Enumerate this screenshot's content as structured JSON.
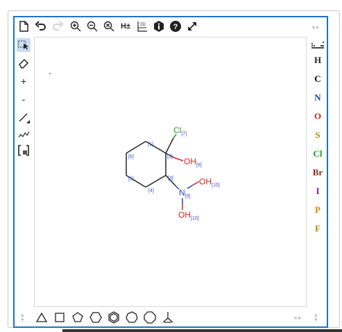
{
  "toolbar_top": {
    "hydrogen_toggle_label": "H±"
  },
  "elements": [
    {
      "symbol": "H",
      "color": "#222222"
    },
    {
      "symbol": "C",
      "color": "#000000"
    },
    {
      "symbol": "N",
      "color": "#1f3fbf"
    },
    {
      "symbol": "O",
      "color": "#e0201c"
    },
    {
      "symbol": "S",
      "color": "#b39100"
    },
    {
      "symbol": "Cl",
      "color": "#1f9e1f"
    },
    {
      "symbol": "Br",
      "color": "#8b2a1a"
    },
    {
      "symbol": "I",
      "color": "#7a1fa0"
    },
    {
      "symbol": "P",
      "color": "#d48a00"
    },
    {
      "symbol": "F",
      "color": "#b38a00"
    }
  ],
  "left_tools": {
    "plus_label": "+",
    "minus_label": "-"
  },
  "molecule": {
    "atoms": {
      "cl": {
        "label": "Cl",
        "index": "[7]",
        "color": "#1f9e1f"
      },
      "oh1": {
        "label": "OH",
        "index": "[8]",
        "color": "#e0201c"
      },
      "n": {
        "label": "N",
        "index": "[9]",
        "color": "#1f3fbf"
      },
      "oh2": {
        "label": "OH",
        "index": "[10]",
        "color": "#e0201c"
      },
      "oh3": {
        "label": "OH",
        "index": "[10]",
        "color": "#e0201c"
      }
    },
    "ring_indices": [
      "[1]",
      "[2]",
      "[3]",
      "[4]",
      "[5]",
      "[6]"
    ]
  },
  "colors": {
    "accent": "#1a73c9",
    "index_blue": "#3a4fd8"
  }
}
